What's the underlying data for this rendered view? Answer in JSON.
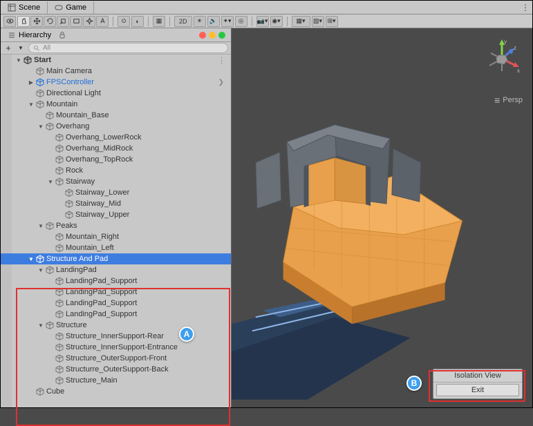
{
  "tabs": {
    "scene": "Scene",
    "game": "Game"
  },
  "hierarchy": {
    "title": "Hierarchy",
    "search_placeholder": "All",
    "scene_name": "Start",
    "items": [
      {
        "name": "Main Camera",
        "depth": 1
      },
      {
        "name": "FPSController",
        "depth": 1,
        "blue": true,
        "expandable": true,
        "collapsed": true,
        "arrow": true
      },
      {
        "name": "Directional Light",
        "depth": 1
      },
      {
        "name": "Mountain",
        "depth": 1,
        "expandable": true
      },
      {
        "name": "Mountain_Base",
        "depth": 2
      },
      {
        "name": "Overhang",
        "depth": 2,
        "expandable": true
      },
      {
        "name": "Overhang_LowerRock",
        "depth": 3
      },
      {
        "name": "Overhang_MidRock",
        "depth": 3
      },
      {
        "name": "Overhang_TopRock",
        "depth": 3
      },
      {
        "name": "Rock",
        "depth": 3
      },
      {
        "name": "Stairway",
        "depth": 3,
        "expandable": true
      },
      {
        "name": "Stairway_Lower",
        "depth": 4
      },
      {
        "name": "Stairway_Mid",
        "depth": 4
      },
      {
        "name": "Stairway_Upper",
        "depth": 4
      },
      {
        "name": "Peaks",
        "depth": 2,
        "expandable": true
      },
      {
        "name": "Mountain_Right",
        "depth": 3
      },
      {
        "name": "Mountain_Left",
        "depth": 3
      },
      {
        "name": "Structure And Pad",
        "depth": 1,
        "expandable": true,
        "selected": true
      },
      {
        "name": "LandingPad",
        "depth": 2,
        "expandable": true
      },
      {
        "name": "LandingPad_Support",
        "depth": 3
      },
      {
        "name": "LandingPad_Support",
        "depth": 3
      },
      {
        "name": "LandingPad_Support",
        "depth": 3
      },
      {
        "name": "LandingPad_Support",
        "depth": 3
      },
      {
        "name": "Structure",
        "depth": 2,
        "expandable": true
      },
      {
        "name": "Structure_InnerSupport-Rear",
        "depth": 3
      },
      {
        "name": "Structure_InnerSupport-Entrance",
        "depth": 3
      },
      {
        "name": "Structure_OuterSupport-Front",
        "depth": 3
      },
      {
        "name": "Structurre_OuterSupport-Back",
        "depth": 3
      },
      {
        "name": "Structure_Main",
        "depth": 3
      },
      {
        "name": "Cube",
        "depth": 1
      }
    ]
  },
  "viewport": {
    "persp": "Persp",
    "axes": {
      "x": "x",
      "y": "y",
      "z": "z"
    }
  },
  "isolation": {
    "title": "Isolation View",
    "exit": "Exit"
  },
  "callouts": {
    "a": "A",
    "b": "B"
  },
  "toolbar": {
    "mode_2d": "2D"
  }
}
